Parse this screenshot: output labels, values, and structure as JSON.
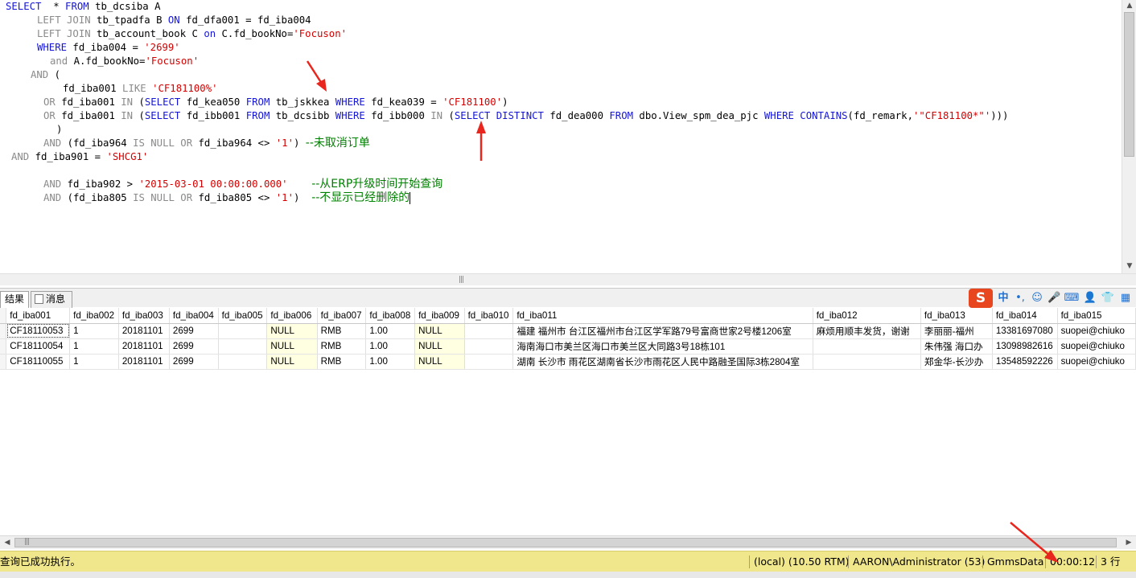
{
  "editor": {
    "lines": [
      {
        "text": "SELECT  * FROM tb_dcsiba A"
      },
      {
        "text": "LEFT JOIN tb_tpadfa B ON fd_dfa001 = fd_iba004"
      },
      {
        "text": "LEFT JOIN tb_account_book C on C.fd_bookNo='Focuson'"
      },
      {
        "text": "WHERE fd_iba004 = '2699'"
      },
      {
        "text": "and A.fd_bookNo='Focuson'"
      },
      {
        "text": "AND ("
      },
      {
        "text": "fd_iba001 LIKE 'CF181100%'"
      },
      {
        "text": "OR fd_iba001 IN (SELECT fd_kea050 FROM tb_jskkea WHERE fd_kea039 = 'CF181100')"
      },
      {
        "text": "OR fd_iba001 IN (SELECT fd_ibb001 FROM tb_dcsibb WHERE fd_ibb000 IN (SELECT DISTINCT fd_dea000 FROM dbo.View_spm_dea_pjc WHERE CONTAINS(fd_remark,'\"CF181100*\"')))"
      },
      {
        "text": ")"
      },
      {
        "text": "AND (fd_iba964 IS NULL OR fd_iba964 <> '1') --未取消订单"
      },
      {
        "text": "AND fd_iba901 = 'SHCG1'"
      },
      {
        "text": ""
      },
      {
        "text": "AND fd_iba902 > '2015-03-01 00:00:00.000'    --从ERP升级时间开始查询"
      },
      {
        "text": "AND (fd_iba805 IS NULL OR fd_iba805 <> '1')  --不显示已经删除的"
      }
    ]
  },
  "tabs": {
    "results": "结果",
    "messages": "消息"
  },
  "ime": {
    "logo": "S",
    "lang": "中",
    "punct": "•,"
  },
  "grid": {
    "columns": [
      "fd_iba001",
      "fd_iba002",
      "fd_iba003",
      "fd_iba004",
      "fd_iba005",
      "fd_iba006",
      "fd_iba007",
      "fd_iba008",
      "fd_iba009",
      "fd_iba010",
      "fd_iba011",
      "fd_iba012",
      "fd_iba013",
      "fd_iba014",
      "fd_iba015"
    ],
    "rows": [
      [
        "CF18110053",
        "1",
        "20181101",
        "2699",
        "",
        "NULL",
        "RMB",
        "1.00",
        "NULL",
        "",
        "福建 福州市 台江区福州市台江区学军路79号富商世家2号楼1206室",
        "麻烦用顺丰发货，谢谢",
        "李丽丽-福州",
        "13381697080",
        "suopei@chiuko"
      ],
      [
        "CF18110054",
        "1",
        "20181101",
        "2699",
        "",
        "NULL",
        "RMB",
        "1.00",
        "NULL",
        "",
        "海南海口市美兰区海口市美兰区大同路3号18栋101",
        "",
        "朱伟强 海口办",
        "13098982616",
        "suopei@chiuko"
      ],
      [
        "CF18110055",
        "1",
        "20181101",
        "2699",
        "",
        "NULL",
        "RMB",
        "1.00",
        "NULL",
        "",
        "湖南 长沙市 雨花区湖南省长沙市雨花区人民中路融圣国际3栋2804室",
        "",
        "郑金华-长沙办",
        "13548592226",
        "suopei@chiuko"
      ]
    ]
  },
  "status": {
    "message": "查询已成功执行。",
    "server": "(local) (10.50 RTM)",
    "user": "AARON\\Administrator (53)",
    "database": "GmmsData",
    "elapsed": "00:00:12",
    "rows": "3 行"
  },
  "colors": {
    "keyword": "#1515d8",
    "string": "#d40000",
    "comment": "#008000",
    "status_bar": "#f0e68c",
    "arrow": "#e8261e"
  }
}
